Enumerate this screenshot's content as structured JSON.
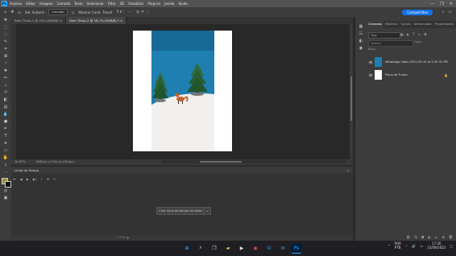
{
  "app": {
    "logo": "Ps"
  },
  "menu": [
    "Arquivo",
    "Editar",
    "Imagem",
    "Camada",
    "Texto",
    "Selecionar",
    "Filtro",
    "3D",
    "Visualizar",
    "Plug-ins",
    "Janela",
    "Ajuda"
  ],
  "window_controls": [
    "—",
    "❐",
    "✕"
  ],
  "options": {
    "auto_select_label": "Sel. Automt.:",
    "layer_select": "Camada",
    "transform_label": "Mostrar Contr. Transf.",
    "share_button": "Compartilhar"
  },
  "document_tabs": [
    {
      "label": "Sem Título-1 @ 25% (RGB/8)"
    },
    {
      "label": "Sem Título-2 @ 16,7% (RGB/8) *"
    }
  ],
  "status": {
    "zoom": "16,67%",
    "doc_size": "1080 px x 1344 px (96 ppi)"
  },
  "timeline": {
    "title": "Linha do Tempo",
    "create_button": "Criar linha do tempo do vídeo",
    "dropdown": "⌄"
  },
  "panel": {
    "tabs": [
      "Camadas",
      "Histórico",
      "Canais",
      "Demarcador",
      "Propriedades"
    ],
    "active_tab": "Camadas",
    "search": "Tipo",
    "blend": "Normal",
    "opacity": "Opac.:",
    "lock": "Bloq.:",
    "layers": [
      {
        "name": "WhatsApp Video 2022-09-15 at 5.35.31 PM",
        "visible": true
      },
      {
        "name": "Plano de Fundo",
        "visible": true
      }
    ]
  },
  "taskbar": {
    "lang": "POR",
    "lang2": "PTB",
    "time": "17:26",
    "date": "15/09/2022"
  },
  "colors": {
    "accent": "#1473e6",
    "photoshop_blue": "#31a8ff",
    "wall": "#1e7fb0",
    "table": "#f2f0ee"
  }
}
